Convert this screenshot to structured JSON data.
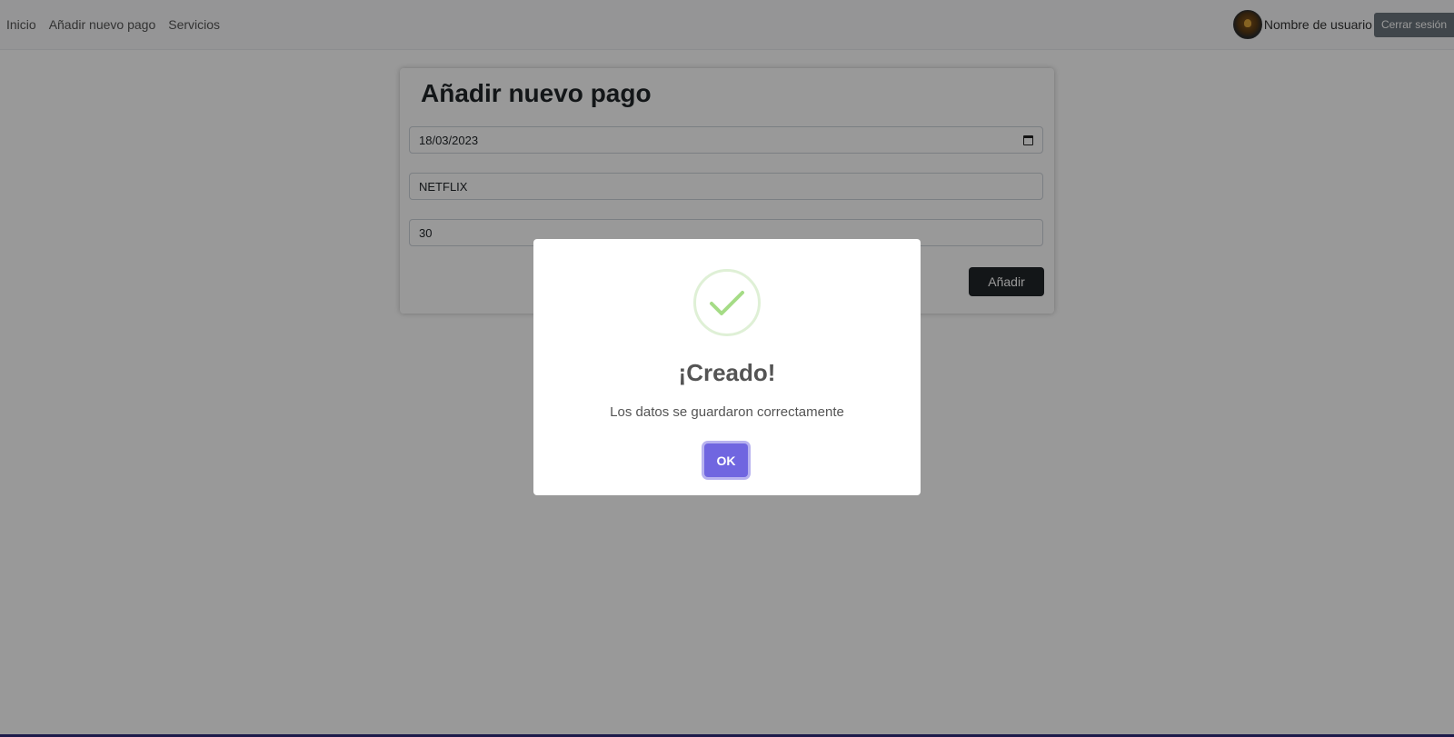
{
  "navbar": {
    "links": [
      "Inicio",
      "Añadir nuevo pago",
      "Servicios"
    ],
    "username": "Nombre de usuario",
    "logout_label": "Cerrar sesión"
  },
  "form": {
    "title": "Añadir nuevo pago",
    "date_value": "18/03/2023",
    "service_value": "NETFLIX",
    "amount_value": "30",
    "submit_label": "Añadir"
  },
  "modal": {
    "icon": "success-check-icon",
    "title": "¡Creado!",
    "text": "Los datos se guardaron correctamente",
    "ok_label": "OK"
  },
  "colors": {
    "confirm_button": "#7066e0",
    "success_icon": "#a5dc86",
    "primary_button": "#212529"
  }
}
